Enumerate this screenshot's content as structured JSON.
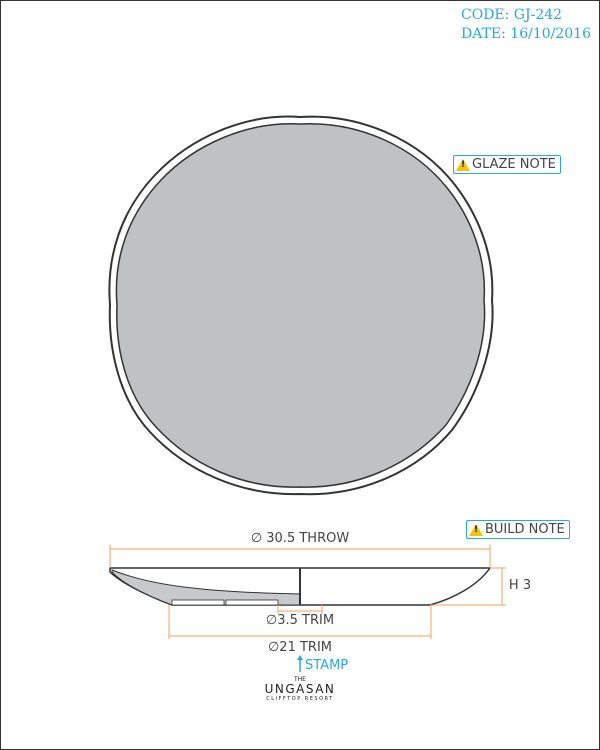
{
  "header": {
    "code": "CODE: GJ-242",
    "date": "DATE: 16/10/2016"
  },
  "notes": {
    "glaze": "GLAZE NOTE",
    "build": "BUILD NOTE",
    "icon": "warning-icon"
  },
  "dimensions": {
    "throw": "∅ 30.5 THROW",
    "height": "H 3",
    "foot_trim": "∅3.5 TRIM",
    "base_trim": "∅21 TRIM"
  },
  "stamp": {
    "label": "STAMP"
  },
  "logo": {
    "the": "THE",
    "name": "UNGASAN",
    "tagline": "CLIFFTOP RESORT"
  },
  "colors": {
    "plate": "#c0c1c3",
    "dimension": "#f0a060",
    "annotation": "#29a8df"
  }
}
